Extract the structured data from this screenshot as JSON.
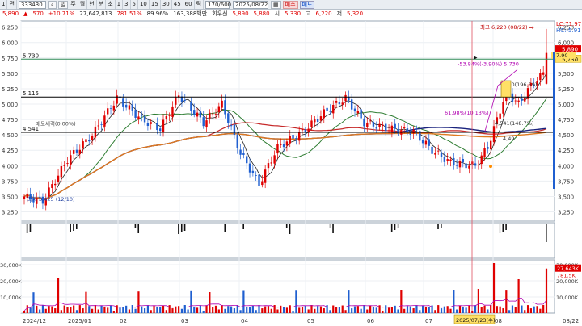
{
  "toolbar": {
    "menu_button": "1",
    "market_select": "전",
    "stock_code": "333430",
    "period_label": "일",
    "period_options": [
      "주",
      "월",
      "년",
      "분",
      "초",
      "1",
      "3",
      "5",
      "10",
      "15",
      "30",
      "45",
      "60",
      "틱"
    ],
    "count_value": "170/600",
    "date_value": "2025/08/22",
    "buy_label": "매수",
    "sell_label": "매도"
  },
  "quote": {
    "price": "5,890",
    "change": "570",
    "change_pct": "+10.71%",
    "volume": "27,642,813",
    "volume_ratio": "781.51%",
    "other_pct": "89.96%",
    "trade_amount": "163,388백만",
    "issuer": "회우선",
    "ask_price": "5,890",
    "bid_price": "5,880",
    "open_label": "시",
    "open": "5,330",
    "high_label": "고",
    "high": "6,220",
    "low_label": "저",
    "low": "5,320"
  },
  "colors": {
    "up": "#e00000",
    "down": "#1f5fd0",
    "ma5": "#202020",
    "ma20": "#2e7d32",
    "ma60": "#c62828",
    "ma120": "#1a237e",
    "ma240": "#e07a1f",
    "hline": "#000000",
    "green_line": "#2e8b57"
  },
  "chart_data": {
    "type": "candlestick",
    "price_axis": {
      "ticks": [
        "6,250",
        "6,000",
        "5,750",
        "5,500",
        "5,250",
        "5,000",
        "4,750",
        "4,500",
        "4,250",
        "4,000",
        "3,750",
        "3,500",
        "3,250"
      ],
      "range": [
        3100,
        6350
      ]
    },
    "volume_axis": {
      "ticks_left": [
        "30,000K",
        "20,000K",
        "10,000K"
      ],
      "ticks_right": [
        "30,000K",
        "20,000K",
        "10,000K"
      ],
      "range": [
        0,
        33000
      ]
    },
    "x_axis_labels": [
      "2024/12",
      "2025/01",
      "02",
      "03",
      "04",
      "05",
      "06",
      "07",
      "08"
    ],
    "crosshair_date": "2025/07/23(수)",
    "horizontal_lines": [
      {
        "label": "5,730",
        "value": 5730,
        "right_label": "5,730"
      },
      {
        "label": "5,115",
        "value": 5115
      },
      {
        "label": "4,541",
        "value": 4541
      }
    ],
    "right_labels": {
      "lc": "LC:71.97",
      "hc": "HC:-5.91",
      "last_red": "5,890",
      "last_yellow": "5,730",
      "yellow_box": "7.90"
    },
    "annotations": [
      {
        "text": "최고 6,220 (08/22)",
        "value": 6220
      },
      {
        "text": "최저 3,425 (12/10)",
        "value": 3425
      },
      {
        "text": "-53.84%(-3.90%) 5,730",
        "value": 5620
      },
      {
        "text": "61.98%(10.13%)",
        "value": 4830
      },
      {
        "text": "매도세력(0.00%)",
        "value": 4650
      },
      {
        "text": "4,541(148.7%)",
        "value": 4660
      },
      {
        "text": "4,49",
        "value": 4410
      },
      {
        "text": "5,730(196,59)",
        "value": 5290
      }
    ],
    "volume_right_labels": [
      "27,643K",
      "781.5K"
    ]
  }
}
